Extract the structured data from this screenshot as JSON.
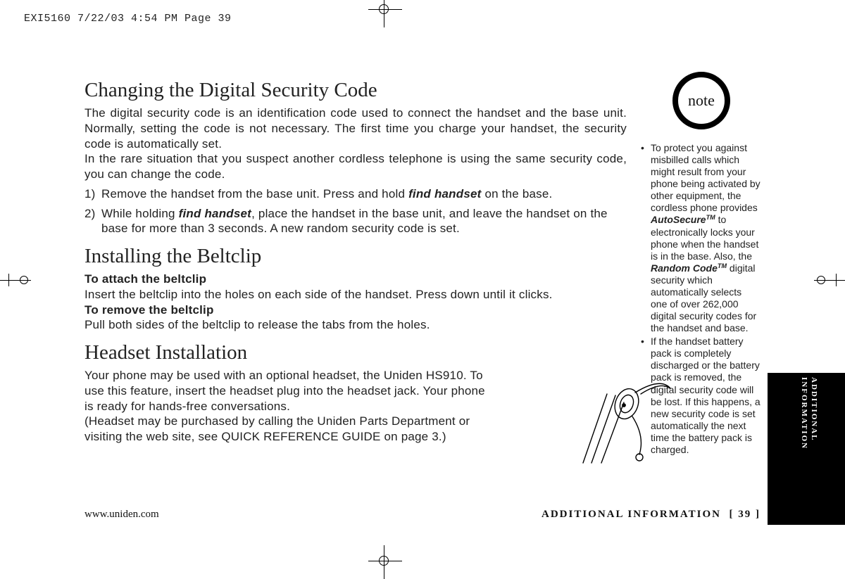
{
  "printers_mark": "EXI5160  7/22/03 4:54 PM  Page 39",
  "note_label": "note",
  "sections": {
    "security": {
      "title": "Changing the Digital Security Code",
      "p1a": "The digital security code is an identification code used to connect the handset and the base unit. Normally, setting the code is not necessary. The first time you charge your handset, the security code is automatically set.",
      "p1b": "In the rare situation that you suspect another cordless telephone is using the same security code, you can change the code.",
      "step1_pre": "Remove the handset from the base unit. Press and hold ",
      "step1_em": "find handset",
      "step1_post": " on the base.",
      "step2_pre": "While holding ",
      "step2_em": "find handset",
      "step2_post": ", place the handset in the base unit, and leave the handset on the base for more than 3 seconds. A new random security code is set."
    },
    "beltclip": {
      "title": "Installing the Beltclip",
      "h_attach": "To attach the beltclip",
      "attach": "Insert the beltclip into the holes on each side of the handset. Press down until it clicks.",
      "h_remove": "To remove the beltclip",
      "remove": "Pull both sides of the beltclip to release the tabs from the holes."
    },
    "headset": {
      "title": "Headset Installation",
      "p": "Your phone may be used with an optional headset, the Uniden HS910. To use this feature, insert the headset plug into the headset jack. Your phone is ready for hands-free conversations.\n(Headset may be purchased by calling the Uniden Parts Department or visiting the web site, see QUICK REFERENCE GUIDE on page 3.)"
    }
  },
  "sidebar": {
    "note1_pre": "To protect you against misbilled calls which might result from your phone being activated by other equipment, the cordless phone provides ",
    "note1_em1": "AutoSecure",
    "note1_mid": " to electronically locks your phone when the handset is in the base. Also, the ",
    "note1_em2": "Random Code",
    "note1_post": " digital security which automatically selects one of over 262,000 digital security codes for the handset and base.",
    "note2": "If the handset battery pack is completely discharged or the battery pack is removed, the digital security code will be lost. If this happens, a new security code is set automatically the next time the battery pack is charged."
  },
  "footer": {
    "url": "www.uniden.com",
    "section": "ADDITIONAL INFORMATION",
    "page": "[ 39 ]"
  },
  "edge_tab": "ADDITIONAL\nINFORMATION"
}
